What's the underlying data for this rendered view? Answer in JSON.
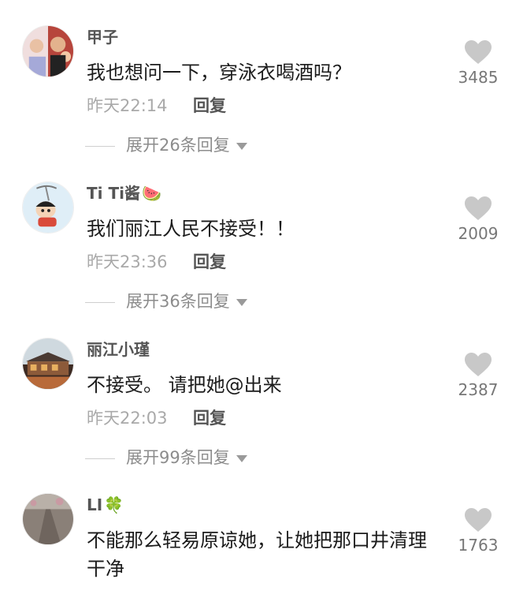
{
  "comments": [
    {
      "name": "甲子",
      "name_emoji": "",
      "text": "我也想问一下，穿泳衣喝酒吗？",
      "time": "昨天22:14",
      "reply_label": "回复",
      "expand_label": "展开26条回复",
      "likes": "3485",
      "avatar_icon": "family-photo-avatar"
    },
    {
      "name": "Ti Ti酱",
      "name_emoji": "🍉",
      "text": "我们丽江人民不接受！！",
      "time": "昨天23:36",
      "reply_label": "回复",
      "expand_label": "展开36条回复",
      "likes": "2009",
      "avatar_icon": "cartoon-avatar"
    },
    {
      "name": "丽江小瑾",
      "name_emoji": "",
      "text": "不接受。 请把她@出来",
      "time": "昨天22:03",
      "reply_label": "回复",
      "expand_label": "展开99条回复",
      "likes": "2387",
      "avatar_icon": "building-photo-avatar"
    },
    {
      "name": "LI",
      "name_emoji": "🍀",
      "text": "不能那么轻易原谅她，让她把那口井清理干净",
      "time": "",
      "reply_label": "",
      "expand_label": "",
      "likes": "1763",
      "avatar_icon": "road-photo-avatar"
    }
  ],
  "colors": {
    "like_icon": "#c8c8c8",
    "name": "#555555",
    "time": "#a9a9a9"
  }
}
